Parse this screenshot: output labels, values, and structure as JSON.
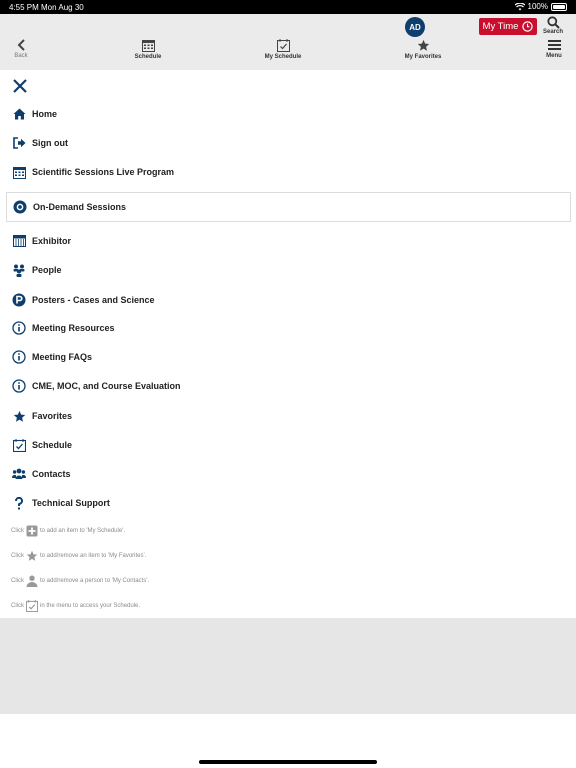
{
  "status_bar": {
    "time": "4:55 PM  Mon Aug 30",
    "battery": "100%"
  },
  "topbar": {
    "back_label": "Back",
    "schedule_label": "Schedule",
    "my_schedule_label": "My Schedule",
    "my_favorites_label": "My Favorites",
    "menu_label": "Menu",
    "avatar_initials": "AD",
    "my_time_label": "My Time",
    "search_label": "Search"
  },
  "menu": {
    "items": [
      {
        "label": "Home",
        "icon": "home-icon"
      },
      {
        "label": "Sign out",
        "icon": "sign-out-icon"
      },
      {
        "label": "Scientific Sessions Live Program",
        "icon": "calendar-icon"
      },
      {
        "label": "On-Demand Sessions",
        "icon": "o-circle-icon",
        "selected": true
      },
      {
        "label": "Exhibitor",
        "icon": "exhibitor-icon"
      },
      {
        "label": "People",
        "icon": "people-icon"
      },
      {
        "label": "Posters - Cases and Science",
        "icon": "p-circle-icon"
      },
      {
        "label": "Meeting Resources",
        "icon": "info-icon"
      },
      {
        "label": "Meeting FAQs",
        "icon": "info-icon"
      },
      {
        "label": "CME, MOC, and Course Evaluation",
        "icon": "info-icon"
      },
      {
        "label": "Favorites",
        "icon": "star-icon"
      },
      {
        "label": "Schedule",
        "icon": "calendar-check-icon"
      },
      {
        "label": "Contacts",
        "icon": "contacts-icon"
      },
      {
        "label": "Technical Support",
        "icon": "question-icon"
      }
    ]
  },
  "hints": [
    {
      "prefix": "Click",
      "suffix": "to add an item to 'My Schedule'.",
      "icon": "plus-square-icon"
    },
    {
      "prefix": "Click",
      "suffix": "to add/remove an item to 'My Favorites'.",
      "icon": "star-icon"
    },
    {
      "prefix": "Click",
      "suffix": "to add/remove a person to 'My Contacts'.",
      "icon": "person-icon"
    },
    {
      "prefix": "Click",
      "suffix": "in the menu to access your Schedule.",
      "icon": "calendar-check-icon"
    }
  ],
  "colors": {
    "accent_navy": "#0d3e6e",
    "my_time_red": "#c8102e",
    "topbar_gray": "#ebebeb"
  }
}
